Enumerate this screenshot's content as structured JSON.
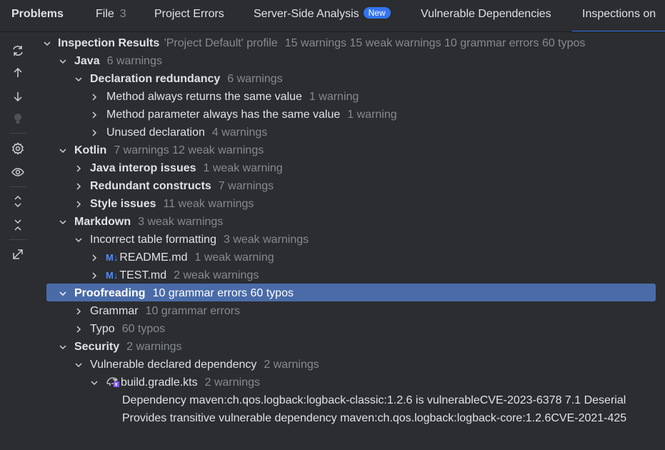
{
  "tabs": {
    "title": "Problems",
    "file": {
      "label": "File",
      "count": "3"
    },
    "project_errors": "Project Errors",
    "server_side": {
      "label": "Server-Side Analysis",
      "badge": "New"
    },
    "vuln_deps": "Vulnerable Dependencies",
    "inspections": "Inspections on"
  },
  "toolbar": {
    "icons": [
      "rerun-icon",
      "arrow-up-icon",
      "arrow-down-icon",
      "lightbulb-icon",
      "settings-icon",
      "eye-icon",
      "expand-all-icon",
      "collapse-all-icon",
      "export-icon"
    ]
  },
  "tree": {
    "root": {
      "label": "Inspection Results",
      "profile": "'Project Default' profile",
      "meta": "15 warnings 15 weak warnings 10 grammar errors 60 typos"
    },
    "java": {
      "label": "Java",
      "meta": "6 warnings"
    },
    "decl_redundancy": {
      "label": "Declaration redundancy",
      "meta": "6 warnings"
    },
    "method_same_value": {
      "label": "Method always returns the same value",
      "meta": "1 warning"
    },
    "method_param_same": {
      "label": "Method parameter always has the same value",
      "meta": "1 warning"
    },
    "unused_decl": {
      "label": "Unused declaration",
      "meta": "4 warnings"
    },
    "kotlin": {
      "label": "Kotlin",
      "meta": "7 warnings 12 weak warnings"
    },
    "java_interop": {
      "label": "Java interop issues",
      "meta": "1 weak warning"
    },
    "redundant_constructs": {
      "label": "Redundant constructs",
      "meta": "7 warnings"
    },
    "style_issues": {
      "label": "Style issues",
      "meta": "11 weak warnings"
    },
    "markdown": {
      "label": "Markdown",
      "meta": "3 weak warnings"
    },
    "incorrect_table": {
      "label": "Incorrect table formatting",
      "meta": "3 weak warnings"
    },
    "readme": {
      "icon": "M↓",
      "label": "README.md",
      "meta": "1 weak warning"
    },
    "test_md": {
      "icon": "M↓",
      "label": "TEST.md",
      "meta": "2 weak warnings"
    },
    "proofreading": {
      "label": "Proofreading",
      "meta": "10 grammar errors 60 typos"
    },
    "grammar": {
      "label": "Grammar",
      "meta": "10 grammar errors"
    },
    "typo": {
      "label": "Typo",
      "meta": "60 typos"
    },
    "security": {
      "label": "Security",
      "meta": "2 warnings"
    },
    "vuln_declared": {
      "label": "Vulnerable declared dependency",
      "meta": "2 warnings"
    },
    "build_gradle": {
      "label": "build.gradle.kts",
      "meta": "2 warnings"
    },
    "dep1": "Dependency maven:ch.qos.logback:logback-classic:1.2.6 is vulnerableCVE-2023-6378 7.1 Deserial",
    "dep2": "Provides transitive vulnerable dependency maven:ch.qos.logback:logback-core:1.2.6CVE-2021-425"
  },
  "colors": {
    "background": "#2b2d30",
    "selection": "#4a6ba8",
    "accent": "#3574f0",
    "muted_text": "#868a91"
  }
}
